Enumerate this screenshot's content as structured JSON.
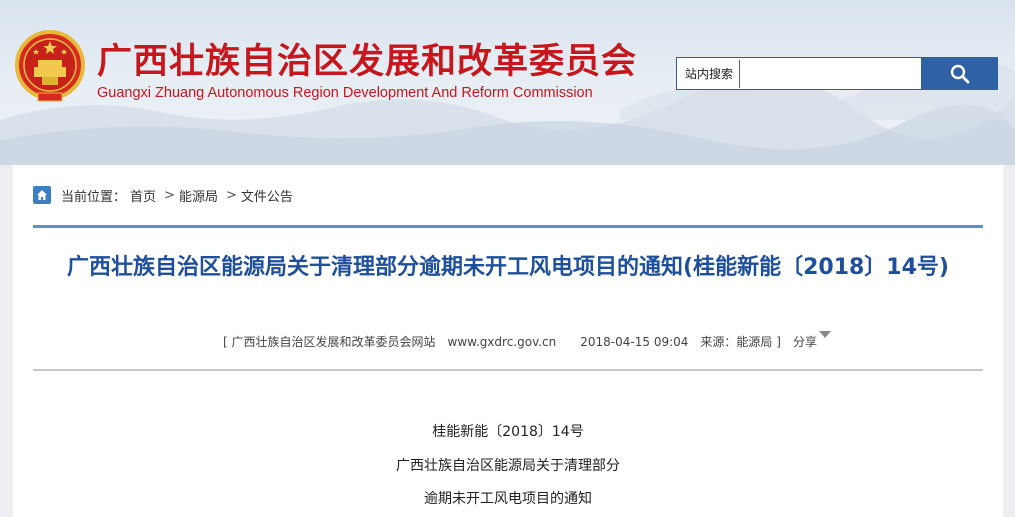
{
  "header": {
    "title": "广西壮族自治区发展和改革委员会",
    "subtitle": "Guangxi Zhuang Autonomous Region Development And Reform Commission"
  },
  "search": {
    "label": "站内搜索",
    "value": "",
    "button_icon": "search-icon"
  },
  "breadcrumb": {
    "prefix": "当前位置：",
    "items": [
      "首页",
      "能源局",
      "文件公告"
    ],
    "separator": ">"
  },
  "article": {
    "title": "广西壮族自治区能源局关于清理部分逾期未开工风电项目的通知(桂能新能〔2018〕14号)",
    "meta": {
      "open_bracket": "[",
      "site": "广西壮族自治区发展和改革委员会网站",
      "url": "www.gxdrc.gov.cn",
      "datetime": "2018-04-15 09:04",
      "source": "来源：能源局",
      "close_bracket": "]",
      "share": "分享"
    },
    "body": [
      "桂能新能〔2018〕14号",
      "广西壮族自治区能源局关于清理部分",
      "逾期未开工风电项目的通知"
    ]
  },
  "colors": {
    "title_red": "#c8161d",
    "accent_blue": "#2f62a4",
    "article_title_blue": "#1d4f9c"
  }
}
